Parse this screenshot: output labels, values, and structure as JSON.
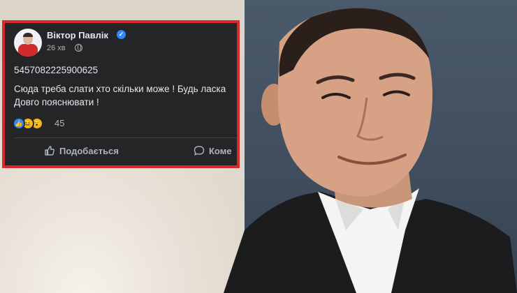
{
  "post": {
    "author": "Віктор Павлік",
    "time": "26 хв",
    "account_number": "5457082225900625",
    "text_line1": "Сюда треба слати хто скільки може ! Будь ласка",
    "text_line2": "Довго пояснювати !",
    "reactions_count": "45",
    "reaction_types": [
      "like-icon",
      "haha-icon",
      "wow-icon"
    ]
  },
  "actions": {
    "like_label": "Подобається",
    "comment_label": "Коме"
  },
  "colors": {
    "frame_border": "#d42a2a",
    "card_bg": "#242526",
    "accent": "#2d88ff"
  }
}
